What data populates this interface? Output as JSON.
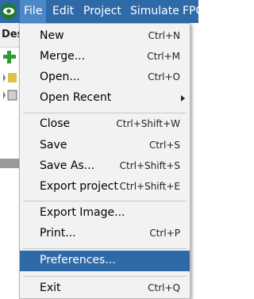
{
  "menubar": {
    "logo_icon": "eye-logo-icon",
    "menus": [
      "File",
      "Edit",
      "Project",
      "Simulate",
      "FPG"
    ]
  },
  "background": {
    "panel_title": "Des"
  },
  "file_menu": {
    "items": [
      {
        "label": "New",
        "shortcut": "Ctrl+N"
      },
      {
        "label": "Merge...",
        "shortcut": "Ctrl+M"
      },
      {
        "label": "Open...",
        "shortcut": "Ctrl+O"
      },
      {
        "label": "Open Recent",
        "shortcut": ""
      },
      {
        "label": "Close",
        "shortcut": "Ctrl+Shift+W"
      },
      {
        "label": "Save",
        "shortcut": "Ctrl+S"
      },
      {
        "label": "Save As...",
        "shortcut": "Ctrl+Shift+S"
      },
      {
        "label": "Export project",
        "shortcut": "Ctrl+Shift+E"
      },
      {
        "label": "Export Image...",
        "shortcut": ""
      },
      {
        "label": "Print...",
        "shortcut": "Ctrl+P"
      },
      {
        "label": "Preferences...",
        "shortcut": ""
      },
      {
        "label": "Exit",
        "shortcut": "Ctrl+Q"
      }
    ],
    "highlighted": "Preferences..."
  },
  "colors": {
    "menubar_bg": "#2f6aa8",
    "active_menu_bg": "#4a88c7",
    "highlight_bg": "#2f6aa8",
    "menu_bg": "#f2f2f2"
  }
}
